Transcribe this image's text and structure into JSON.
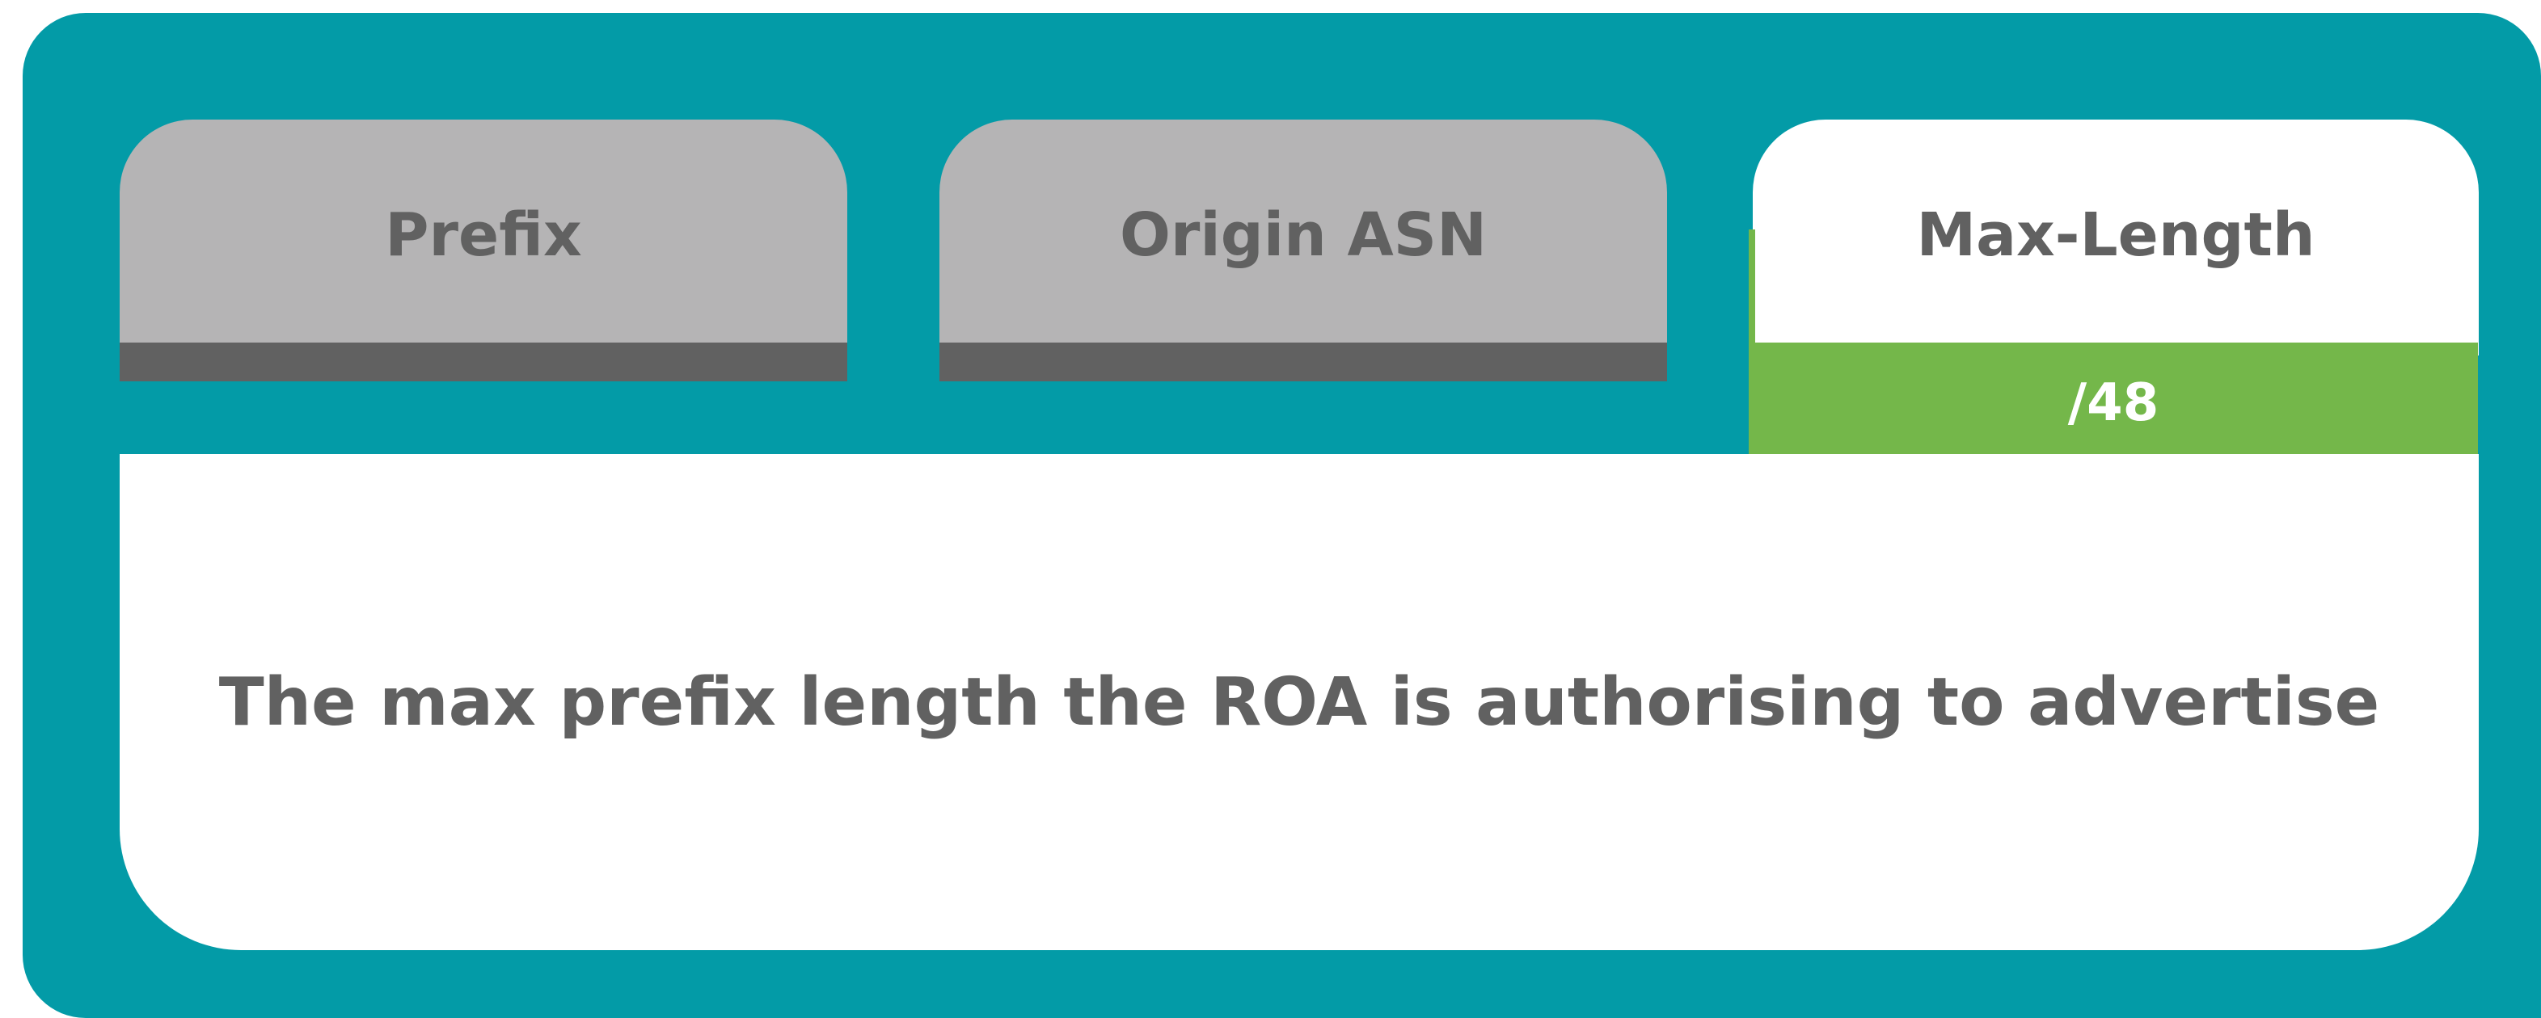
{
  "tabs": [
    {
      "label": "Prefix",
      "state": "inactive"
    },
    {
      "label": "Origin ASN",
      "state": "inactive"
    },
    {
      "label": "Max-Length",
      "state": "active",
      "value": "/48"
    }
  ],
  "description": "The max prefix length the ROA is authorising to advertise",
  "colors": {
    "background": "#039ba7",
    "inactive_tab": "#b5b4b5",
    "tab_underline": "#616161",
    "active_value": "#74b74a",
    "text": "#616161"
  }
}
